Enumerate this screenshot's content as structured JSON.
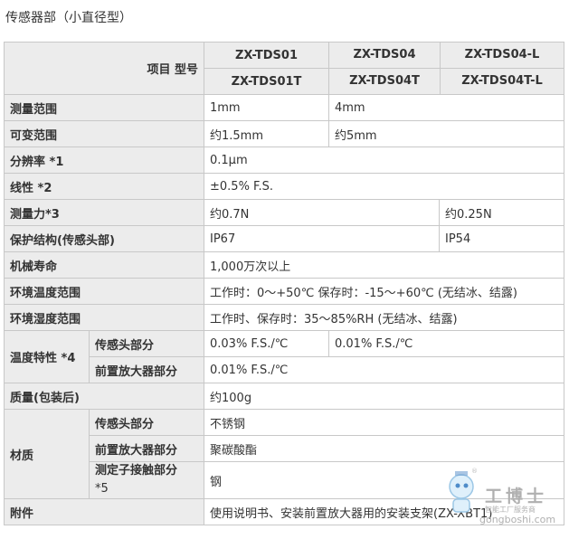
{
  "title": "传感器部（小直径型）",
  "header": {
    "corner": "项目 型号",
    "models_row1": [
      "ZX-TDS01",
      "ZX-TDS04",
      "ZX-TDS04-L"
    ],
    "models_row2": [
      "ZX-TDS01T",
      "ZX-TDS04T",
      "ZX-TDS04T-L"
    ]
  },
  "rows": {
    "range": {
      "label": "测量范围",
      "v1": "1mm",
      "v2": "4mm"
    },
    "variable": {
      "label": "可变范围",
      "v1": "约1.5mm",
      "v2": "约5mm"
    },
    "resolution": {
      "label": "分辨率 *1",
      "v": "0.1μm"
    },
    "linearity": {
      "label": "线性 *2",
      "v": "±0.5% F.S."
    },
    "force": {
      "label": "测量力*3",
      "v1": "约0.7N",
      "v2": "约0.25N"
    },
    "protection": {
      "label": "保护结构(传感头部)",
      "v1": "IP67",
      "v2": "IP54"
    },
    "life": {
      "label": "机械寿命",
      "v": "1,000万次以上"
    },
    "temp_range": {
      "label": "环境温度范围",
      "v": "工作时：0～+50℃ 保存时：-15～+60℃ (无结冰、结露)"
    },
    "humid_range": {
      "label": "环境湿度范围",
      "v": "工作时、保存时：35～85%RH (无结冰、结露)"
    },
    "temp_char": {
      "label": "温度特性 *4",
      "sub1": "传感头部分",
      "sub1_v1": "0.03% F.S./℃",
      "sub1_v2": "0.01% F.S./℃",
      "sub2": "前置放大器部分",
      "sub2_v": "0.01% F.S./℃"
    },
    "mass": {
      "label": "质量(包装后)",
      "v": "约100g"
    },
    "material": {
      "label": "材质",
      "sub1": "传感头部分",
      "sub1_v": "不锈钢",
      "sub2": "前置放大器部分",
      "sub2_v": "聚碳酸酯",
      "sub3_line1": "测定子接触部分",
      "sub3_line2": "*5",
      "sub3_v": "钢"
    },
    "accessory": {
      "label": "附件",
      "v": "使用说明书、安装前置放大器用的安装支架(ZX-XBT1)"
    }
  },
  "watermark": {
    "brand": "工博士",
    "sub": "智能工厂服务商",
    "url": "gongboshi.com"
  }
}
